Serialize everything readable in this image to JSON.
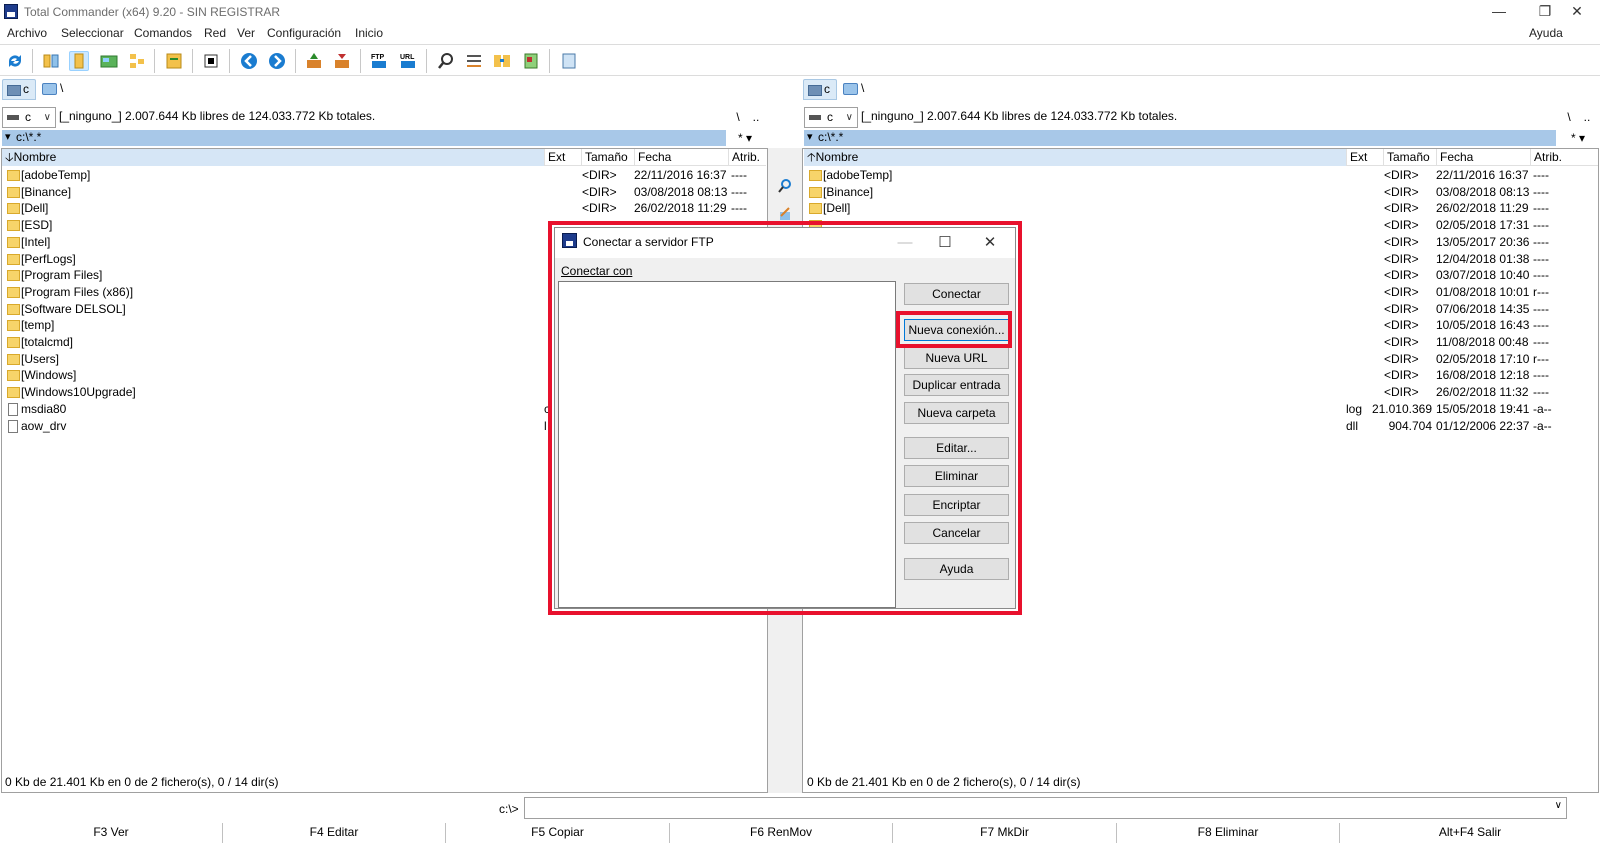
{
  "window": {
    "title": "Total Commander (x64) 9.20 - SIN REGISTRAR",
    "minimize": "—",
    "restore": "❐",
    "close": "✕"
  },
  "menu": [
    "Archivo",
    "Seleccionar",
    "Comandos",
    "Red",
    "Ver",
    "Configuración",
    "Inicio"
  ],
  "menu_help": "Ayuda",
  "toolbar_icons": [
    "refresh-icon",
    "brief-view-icon",
    "full-view-icon",
    "thumbnails-icon",
    "tree-icon",
    "compare-dirs-icon",
    "invert-select-icon",
    "back-icon",
    "forward-icon",
    "pack-icon",
    "unpack-icon",
    "ftp-icon",
    "url-icon",
    "search-icon",
    "multi-rename-icon",
    "sync-dirs-icon",
    "file-attrs-icon",
    "notepad-icon"
  ],
  "left": {
    "drive_tab": "c",
    "net_tab": "\\",
    "drive": "c",
    "drive_info": "[_ninguno_]  2.007.644 Kb libres de 124.033.772 Kb totales.",
    "root_btn": "\\",
    "up_btn": "..",
    "path": "c:\\*.*",
    "filter": "*",
    "columns": {
      "name": "Nombre",
      "ext": "Ext",
      "size": "Tamaño",
      "date": "Fecha",
      "attr": "Atrib."
    },
    "status": "0 Kb de 21.401 Kb en 0 de 2 fichero(s), 0 / 14 dir(s)",
    "files": [
      {
        "name": "[adobeTemp]",
        "ext": "",
        "size": "<DIR>",
        "date": "22/11/2016 16:37",
        "attr": "----",
        "type": "folder"
      },
      {
        "name": "[Binance]",
        "ext": "",
        "size": "<DIR>",
        "date": "03/08/2018 08:13",
        "attr": "----",
        "type": "folder"
      },
      {
        "name": "[Dell]",
        "ext": "",
        "size": "<DIR>",
        "date": "26/02/2018 11:29",
        "attr": "----",
        "type": "folder"
      },
      {
        "name": "[ESD]",
        "ext": "",
        "size": "",
        "date": "",
        "attr": "",
        "type": "folder"
      },
      {
        "name": "[Intel]",
        "ext": "",
        "size": "",
        "date": "",
        "attr": "",
        "type": "folder"
      },
      {
        "name": "[PerfLogs]",
        "ext": "",
        "size": "",
        "date": "",
        "attr": "",
        "type": "folder"
      },
      {
        "name": "[Program Files]",
        "ext": "",
        "size": "",
        "date": "",
        "attr": "",
        "type": "folder"
      },
      {
        "name": "[Program Files (x86)]",
        "ext": "",
        "size": "",
        "date": "",
        "attr": "",
        "type": "folder"
      },
      {
        "name": "[Software DELSOL]",
        "ext": "",
        "size": "",
        "date": "",
        "attr": "",
        "type": "folder"
      },
      {
        "name": "[temp]",
        "ext": "",
        "size": "",
        "date": "",
        "attr": "",
        "type": "folder"
      },
      {
        "name": "[totalcmd]",
        "ext": "",
        "size": "",
        "date": "",
        "attr": "",
        "type": "folder"
      },
      {
        "name": "[Users]",
        "ext": "",
        "size": "",
        "date": "",
        "attr": "",
        "type": "folder"
      },
      {
        "name": "[Windows]",
        "ext": "",
        "size": "",
        "date": "",
        "attr": "",
        "type": "folder"
      },
      {
        "name": "[Windows10Upgrade]",
        "ext": "",
        "size": "",
        "date": "",
        "attr": "",
        "type": "folder"
      },
      {
        "name": "msdia80",
        "ext": "c",
        "size": "",
        "date": "",
        "attr": "",
        "type": "file"
      },
      {
        "name": "aow_drv",
        "ext": "l",
        "size": "",
        "date": "",
        "attr": "",
        "type": "file"
      }
    ]
  },
  "right": {
    "drive_tab": "c",
    "net_tab": "\\",
    "drive": "c",
    "drive_info": "[_ninguno_]  2.007.644 Kb libres de 124.033.772 Kb totales.",
    "root_btn": "\\",
    "up_btn": "..",
    "path": "c:\\*.*",
    "filter": "*",
    "columns": {
      "name": "Nombre",
      "ext": "Ext",
      "size": "Tamaño",
      "date": "Fecha",
      "attr": "Atrib."
    },
    "status": "0 Kb de 21.401 Kb en 0 de 2 fichero(s), 0 / 14 dir(s)",
    "files": [
      {
        "name": "[adobeTemp]",
        "ext": "",
        "size": "<DIR>",
        "date": "22/11/2016 16:37",
        "attr": "----",
        "type": "folder"
      },
      {
        "name": "[Binance]",
        "ext": "",
        "size": "<DIR>",
        "date": "03/08/2018 08:13",
        "attr": "----",
        "type": "folder"
      },
      {
        "name": "[Dell]",
        "ext": "",
        "size": "<DIR>",
        "date": "26/02/2018 11:29",
        "attr": "----",
        "type": "folder"
      },
      {
        "name": "",
        "ext": "",
        "size": "<DIR>",
        "date": "02/05/2018 17:31",
        "attr": "----",
        "type": "hidden"
      },
      {
        "name": "",
        "ext": "",
        "size": "<DIR>",
        "date": "13/05/2017 20:36",
        "attr": "----",
        "type": "hidden"
      },
      {
        "name": "",
        "ext": "",
        "size": "<DIR>",
        "date": "12/04/2018 01:38",
        "attr": "----",
        "type": "hidden"
      },
      {
        "name": "",
        "ext": "",
        "size": "<DIR>",
        "date": "03/07/2018 10:40",
        "attr": "----",
        "type": "hidden"
      },
      {
        "name": "",
        "ext": "",
        "size": "<DIR>",
        "date": "01/08/2018 10:01",
        "attr": "r---",
        "type": "hidden"
      },
      {
        "name": "",
        "ext": "",
        "size": "<DIR>",
        "date": "07/06/2018 14:35",
        "attr": "----",
        "type": "hidden"
      },
      {
        "name": "",
        "ext": "",
        "size": "<DIR>",
        "date": "10/05/2018 16:43",
        "attr": "----",
        "type": "hidden"
      },
      {
        "name": "",
        "ext": "",
        "size": "<DIR>",
        "date": "11/08/2018 00:48",
        "attr": "----",
        "type": "hidden"
      },
      {
        "name": "",
        "ext": "",
        "size": "<DIR>",
        "date": "02/05/2018 17:10",
        "attr": "r---",
        "type": "hidden"
      },
      {
        "name": "",
        "ext": "",
        "size": "<DIR>",
        "date": "16/08/2018 12:18",
        "attr": "----",
        "type": "hidden"
      },
      {
        "name": "",
        "ext": "",
        "size": "<DIR>",
        "date": "26/02/2018 11:32",
        "attr": "----",
        "type": "hidden"
      },
      {
        "name": "",
        "ext": "log",
        "size": "21.010.369",
        "date": "15/05/2018 19:41",
        "attr": "-a--",
        "type": "hidden"
      },
      {
        "name": "",
        "ext": "dll",
        "size": "904.704",
        "date": "01/12/2006 22:37",
        "attr": "-a--",
        "type": "hidden"
      }
    ]
  },
  "command_line": {
    "prompt": "c:\\>",
    "value": ""
  },
  "function_keys": [
    "F3 Ver",
    "F4 Editar",
    "F5 Copiar",
    "F6 RenMov",
    "F7 MkDir",
    "F8 Eliminar",
    "Alt+F4 Salir"
  ],
  "dialog": {
    "title": "Conectar a servidor FTP",
    "label": "Conectar con",
    "buttons": [
      "Conectar",
      "Nueva conexión...",
      "Nueva URL",
      "Duplicar entrada",
      "Nueva carpeta",
      "Editar...",
      "Eliminar",
      "Encriptar",
      "Cancelar",
      "Ayuda"
    ],
    "minimize": "—",
    "maximize": "☐",
    "close": "✕"
  },
  "colors": {
    "highlight": "#e8112d",
    "path_bar": "#a8c8e8",
    "folder": "#f7d46a"
  }
}
